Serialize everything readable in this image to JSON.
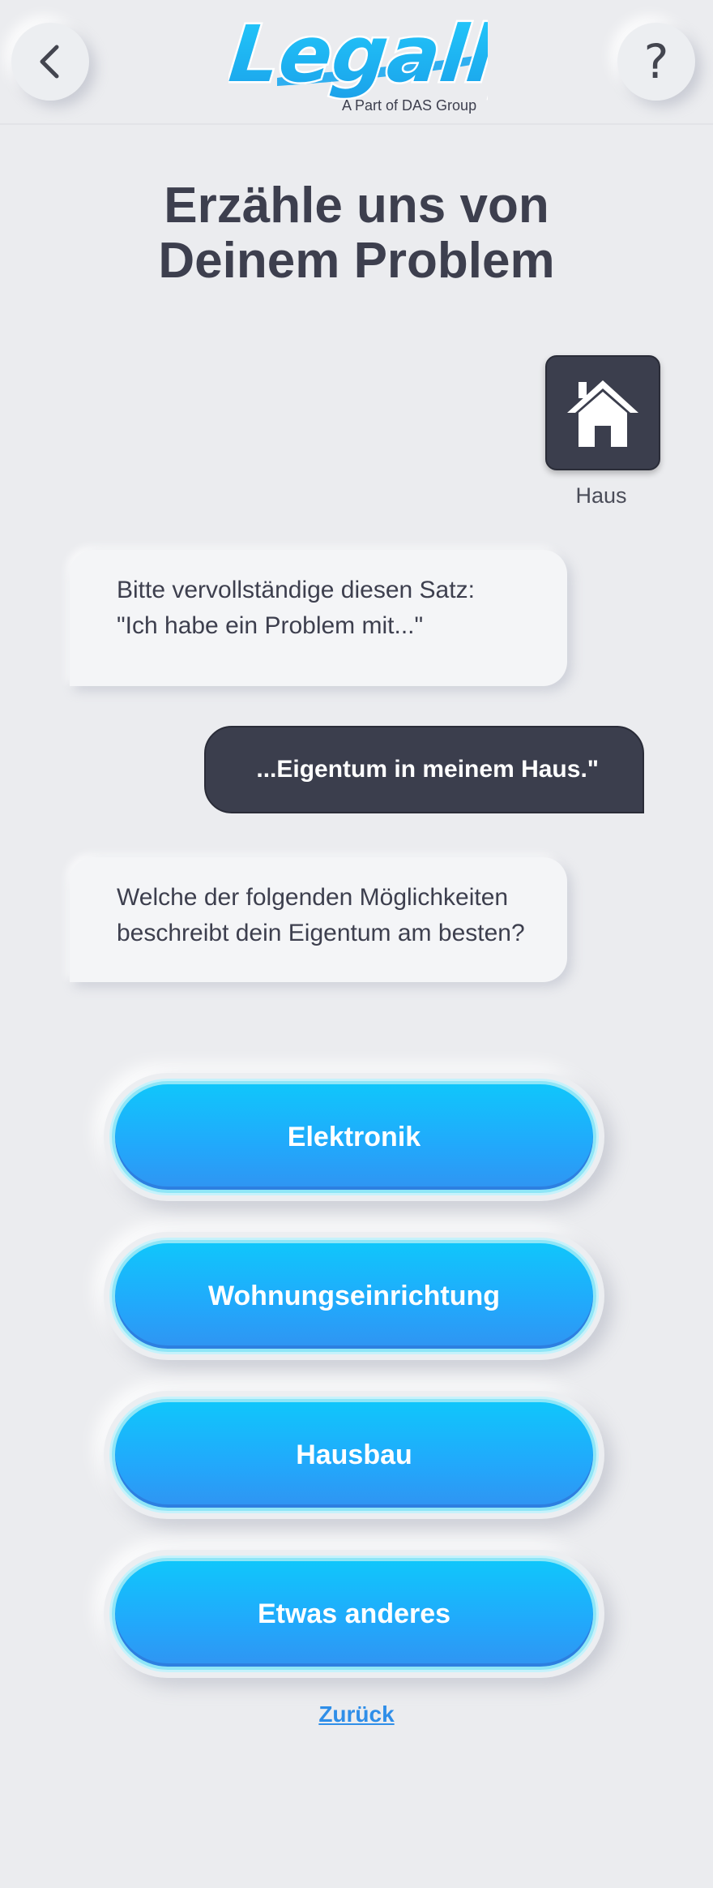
{
  "header": {
    "back_icon": "chevron-left-icon",
    "help_label": "?",
    "logo_text": "Legally",
    "logo_subtitle": "A Part of DAS Group",
    "brand_color": "#1fb8f5"
  },
  "page": {
    "title_line1": "Erzähle uns von",
    "title_line2": "Deinem Problem"
  },
  "category": {
    "icon": "house-icon",
    "label": "Haus"
  },
  "chat": {
    "bot_message_1_line1": "Bitte vervollständige diesen Satz:",
    "bot_message_1_line2": "\"Ich habe ein Problem mit...\"",
    "user_message": "...Eigentum in meinem Haus.\"",
    "bot_message_2_line1": "Welche der folgenden Möglichkeiten",
    "bot_message_2_line2": "beschreibt dein Eigentum am besten?"
  },
  "options": [
    "Elektronik",
    "Wohnungseinrichtung",
    "Hausbau",
    "Etwas anderes"
  ],
  "back_link": "Zurück"
}
